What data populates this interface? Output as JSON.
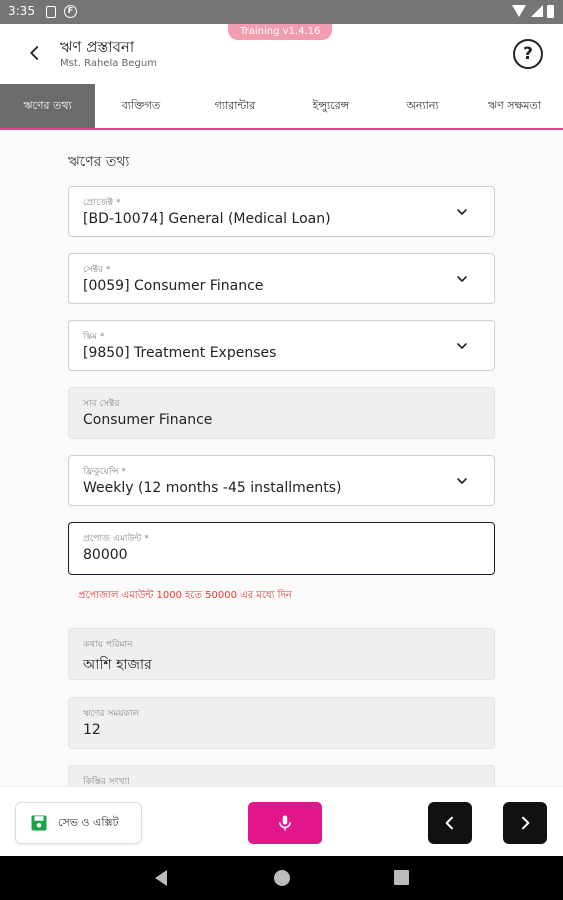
{
  "status_bar": {
    "time": "3:35",
    "icons": [
      "notification-box-icon",
      "f-circle-icon",
      "wifi-icon",
      "signal-icon",
      "battery-icon"
    ],
    "badge_letter": "F"
  },
  "header": {
    "title": "ঋণ প্রস্তাবনা",
    "subtitle": "Mst. Rahela Begum",
    "version": "Training v1.4.16",
    "help_label": "?"
  },
  "tabs": [
    {
      "label": "ঋণের তথ্য",
      "active": true
    },
    {
      "label": "ব্যক্তিগত",
      "active": false
    },
    {
      "label": "গ্যারান্টার",
      "active": false
    },
    {
      "label": "ইন্স্যুরেন্স",
      "active": false
    },
    {
      "label": "অন্যান্য",
      "active": false
    },
    {
      "label": "ঋণ সক্ষমতা",
      "active": false
    }
  ],
  "form": {
    "section_title": "ঋণের তথ্য",
    "project": {
      "label": "প্রোজেক্ট *",
      "value": "[BD-10074] General (Medical Loan)"
    },
    "sector": {
      "label": "সেক্টর *",
      "value": "[0059] Consumer Finance"
    },
    "scheme": {
      "label": "স্কিম *",
      "value": "[9850] Treatment Expenses"
    },
    "subsector": {
      "label": "সাব সেক্টর",
      "value": "Consumer Finance"
    },
    "frequency": {
      "label": "ফ্রিকুয়েন্সি *",
      "value": "Weekly (12 months -45 installments)"
    },
    "amount": {
      "label": "প্রপোজ এমাউন্ট *",
      "value": "80000"
    },
    "amount_error": "প্রপোজাল এমাউন্ট 1000 হতে 50000 এর মধ্যে দিন",
    "in_words": {
      "label": "কথায় পরিমান",
      "value": "আশি হাজার"
    },
    "duration": {
      "label": "ঋণের সময়কাল",
      "value": "12"
    },
    "installments": {
      "label": "কিস্তির সংখ্যা",
      "value": ""
    }
  },
  "actions": {
    "save_exit_label": "সেভ ও এক্সিট",
    "prev_icon": "chevron-left-icon",
    "next_icon": "chevron-right-icon",
    "mic_icon": "microphone-icon"
  },
  "colors": {
    "accent": "#e2168a",
    "tab_active": "#6b6b6b",
    "error": "#e53935",
    "save_icon": "#1aa34a"
  }
}
